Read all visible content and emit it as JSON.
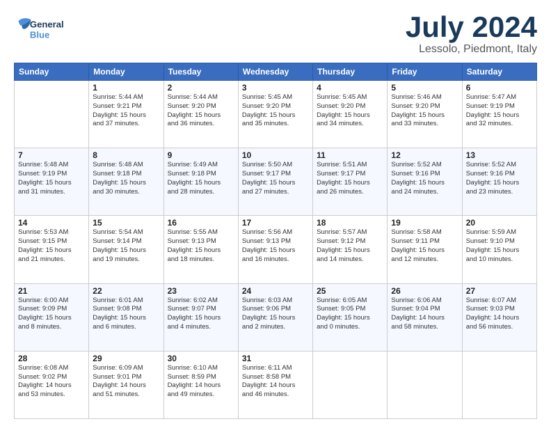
{
  "header": {
    "logo_general": "General",
    "logo_blue": "Blue",
    "title": "July 2024",
    "location": "Lessolo, Piedmont, Italy"
  },
  "weekdays": [
    "Sunday",
    "Monday",
    "Tuesday",
    "Wednesday",
    "Thursday",
    "Friday",
    "Saturday"
  ],
  "weeks": [
    [
      {
        "day": "",
        "info": ""
      },
      {
        "day": "1",
        "info": "Sunrise: 5:44 AM\nSunset: 9:21 PM\nDaylight: 15 hours\nand 37 minutes."
      },
      {
        "day": "2",
        "info": "Sunrise: 5:44 AM\nSunset: 9:20 PM\nDaylight: 15 hours\nand 36 minutes."
      },
      {
        "day": "3",
        "info": "Sunrise: 5:45 AM\nSunset: 9:20 PM\nDaylight: 15 hours\nand 35 minutes."
      },
      {
        "day": "4",
        "info": "Sunrise: 5:45 AM\nSunset: 9:20 PM\nDaylight: 15 hours\nand 34 minutes."
      },
      {
        "day": "5",
        "info": "Sunrise: 5:46 AM\nSunset: 9:20 PM\nDaylight: 15 hours\nand 33 minutes."
      },
      {
        "day": "6",
        "info": "Sunrise: 5:47 AM\nSunset: 9:19 PM\nDaylight: 15 hours\nand 32 minutes."
      }
    ],
    [
      {
        "day": "7",
        "info": "Sunrise: 5:48 AM\nSunset: 9:19 PM\nDaylight: 15 hours\nand 31 minutes."
      },
      {
        "day": "8",
        "info": "Sunrise: 5:48 AM\nSunset: 9:18 PM\nDaylight: 15 hours\nand 30 minutes."
      },
      {
        "day": "9",
        "info": "Sunrise: 5:49 AM\nSunset: 9:18 PM\nDaylight: 15 hours\nand 28 minutes."
      },
      {
        "day": "10",
        "info": "Sunrise: 5:50 AM\nSunset: 9:17 PM\nDaylight: 15 hours\nand 27 minutes."
      },
      {
        "day": "11",
        "info": "Sunrise: 5:51 AM\nSunset: 9:17 PM\nDaylight: 15 hours\nand 26 minutes."
      },
      {
        "day": "12",
        "info": "Sunrise: 5:52 AM\nSunset: 9:16 PM\nDaylight: 15 hours\nand 24 minutes."
      },
      {
        "day": "13",
        "info": "Sunrise: 5:52 AM\nSunset: 9:16 PM\nDaylight: 15 hours\nand 23 minutes."
      }
    ],
    [
      {
        "day": "14",
        "info": "Sunrise: 5:53 AM\nSunset: 9:15 PM\nDaylight: 15 hours\nand 21 minutes."
      },
      {
        "day": "15",
        "info": "Sunrise: 5:54 AM\nSunset: 9:14 PM\nDaylight: 15 hours\nand 19 minutes."
      },
      {
        "day": "16",
        "info": "Sunrise: 5:55 AM\nSunset: 9:13 PM\nDaylight: 15 hours\nand 18 minutes."
      },
      {
        "day": "17",
        "info": "Sunrise: 5:56 AM\nSunset: 9:13 PM\nDaylight: 15 hours\nand 16 minutes."
      },
      {
        "day": "18",
        "info": "Sunrise: 5:57 AM\nSunset: 9:12 PM\nDaylight: 15 hours\nand 14 minutes."
      },
      {
        "day": "19",
        "info": "Sunrise: 5:58 AM\nSunset: 9:11 PM\nDaylight: 15 hours\nand 12 minutes."
      },
      {
        "day": "20",
        "info": "Sunrise: 5:59 AM\nSunset: 9:10 PM\nDaylight: 15 hours\nand 10 minutes."
      }
    ],
    [
      {
        "day": "21",
        "info": "Sunrise: 6:00 AM\nSunset: 9:09 PM\nDaylight: 15 hours\nand 8 minutes."
      },
      {
        "day": "22",
        "info": "Sunrise: 6:01 AM\nSunset: 9:08 PM\nDaylight: 15 hours\nand 6 minutes."
      },
      {
        "day": "23",
        "info": "Sunrise: 6:02 AM\nSunset: 9:07 PM\nDaylight: 15 hours\nand 4 minutes."
      },
      {
        "day": "24",
        "info": "Sunrise: 6:03 AM\nSunset: 9:06 PM\nDaylight: 15 hours\nand 2 minutes."
      },
      {
        "day": "25",
        "info": "Sunrise: 6:05 AM\nSunset: 9:05 PM\nDaylight: 15 hours\nand 0 minutes."
      },
      {
        "day": "26",
        "info": "Sunrise: 6:06 AM\nSunset: 9:04 PM\nDaylight: 14 hours\nand 58 minutes."
      },
      {
        "day": "27",
        "info": "Sunrise: 6:07 AM\nSunset: 9:03 PM\nDaylight: 14 hours\nand 56 minutes."
      }
    ],
    [
      {
        "day": "28",
        "info": "Sunrise: 6:08 AM\nSunset: 9:02 PM\nDaylight: 14 hours\nand 53 minutes."
      },
      {
        "day": "29",
        "info": "Sunrise: 6:09 AM\nSunset: 9:01 PM\nDaylight: 14 hours\nand 51 minutes."
      },
      {
        "day": "30",
        "info": "Sunrise: 6:10 AM\nSunset: 8:59 PM\nDaylight: 14 hours\nand 49 minutes."
      },
      {
        "day": "31",
        "info": "Sunrise: 6:11 AM\nSunset: 8:58 PM\nDaylight: 14 hours\nand 46 minutes."
      },
      {
        "day": "",
        "info": ""
      },
      {
        "day": "",
        "info": ""
      },
      {
        "day": "",
        "info": ""
      }
    ]
  ]
}
